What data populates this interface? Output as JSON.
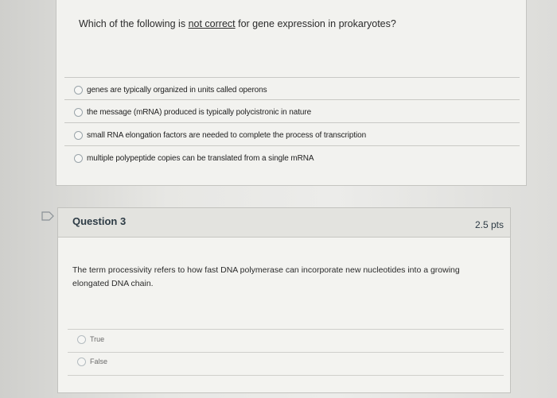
{
  "question2": {
    "text_before": "Which of the following is ",
    "text_underlined": "not correct",
    "text_after": " for gene expression in prokaryotes?",
    "answers": [
      "genes are typically organized in units called operons",
      "the message (mRNA) produced is typically polycistronic in nature",
      "small RNA elongation factors are needed to complete the process of transcription",
      "multiple polypeptide copies can be translated from a single mRNA"
    ]
  },
  "question3": {
    "title": "Question 3",
    "points": "2.5 pts",
    "text": "The term processivity refers to how fast DNA polymerase can incorporate new nucleotides into a growing elongated DNA chain.",
    "answers": [
      "True",
      "False"
    ]
  }
}
